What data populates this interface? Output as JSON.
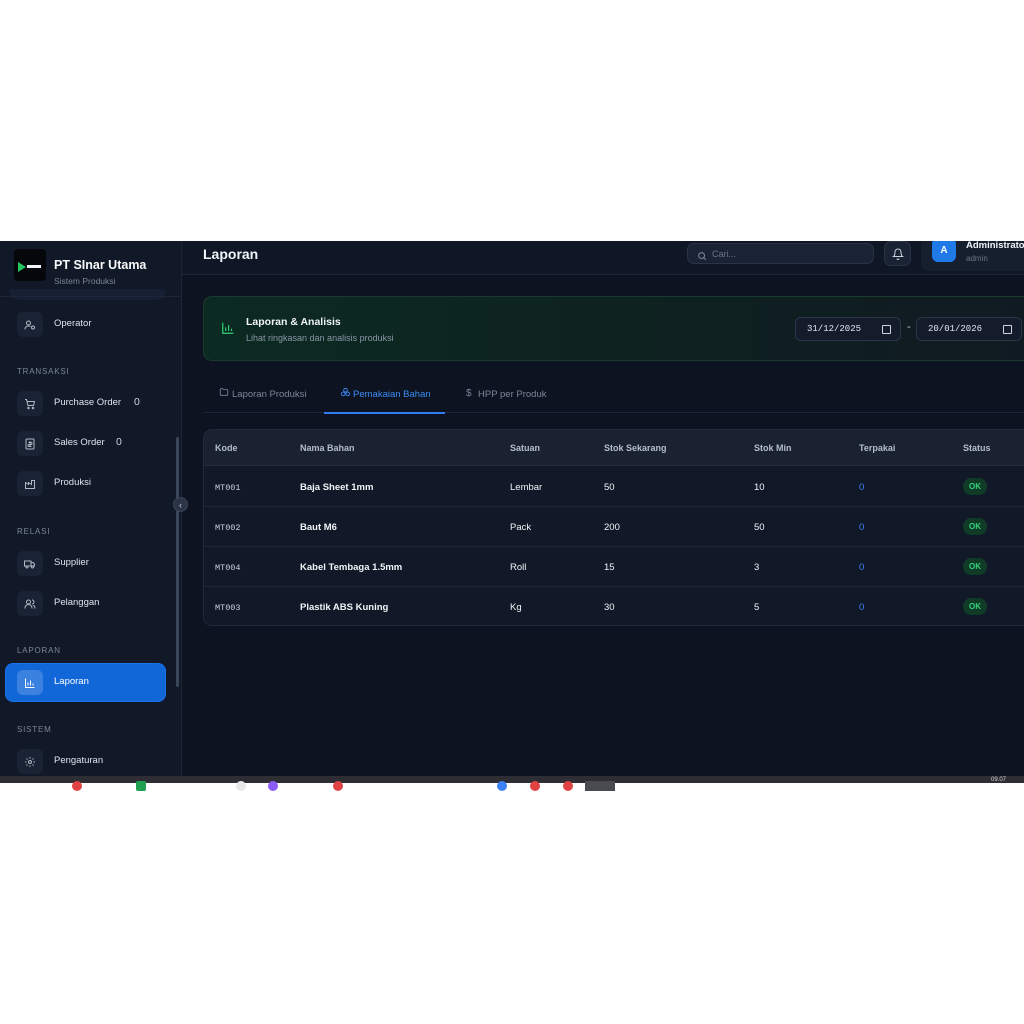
{
  "brand": {
    "name": "PT SInar Utama",
    "subtitle": "Sistem Produksi"
  },
  "sidebar": {
    "sections": {
      "transaksi": "TRANSAKSI",
      "relasi": "RELASI",
      "laporan": "LAPORAN",
      "sistem": "SISTEM"
    },
    "items": {
      "operator": {
        "label": "Operator",
        "icon": "user-cog-icon"
      },
      "purchase_order": {
        "label": "Purchase Order",
        "count": "0",
        "icon": "cart-icon"
      },
      "sales_order": {
        "label": "Sales Order",
        "count": "0",
        "icon": "receipt-icon"
      },
      "produksi": {
        "label": "Produksi",
        "icon": "factory-icon"
      },
      "supplier": {
        "label": "Supplier",
        "icon": "truck-icon"
      },
      "pelanggan": {
        "label": "Pelanggan",
        "icon": "users-icon"
      },
      "laporan": {
        "label": "Laporan",
        "icon": "bar-chart-icon",
        "active": true
      },
      "pengaturan": {
        "label": "Pengaturan",
        "icon": "gear-icon"
      }
    },
    "collapse_icon": "chevron-left-icon"
  },
  "header": {
    "title": "Laporan",
    "search_placeholder": "Cari...",
    "user": {
      "initial": "A",
      "name": "Administrator",
      "role": "admin"
    }
  },
  "banner": {
    "title": "Laporan & Analisis",
    "subtitle": "Lihat ringkasan dan analisis produksi",
    "date_from": "31/12/2025",
    "date_separator": "-",
    "date_to": "20/01/2026"
  },
  "tabs": [
    {
      "label": "Laporan Produksi",
      "icon": "folder-icon"
    },
    {
      "label": "Pemakaian Bahan",
      "icon": "layers-icon",
      "active": true
    },
    {
      "label": "HPP per Produk",
      "icon": "dollar-icon"
    }
  ],
  "table": {
    "columns": [
      "Kode",
      "Nama Bahan",
      "Satuan",
      "Stok Sekarang",
      "Stok Min",
      "Terpakai",
      "Status"
    ],
    "rows": [
      {
        "kode": "MT001",
        "nama": "Baja Sheet 1mm",
        "satuan": "Lembar",
        "stok": "50",
        "min": "10",
        "terpakai": "0",
        "status": "OK"
      },
      {
        "kode": "MT002",
        "nama": "Baut M6",
        "satuan": "Pack",
        "stok": "200",
        "min": "50",
        "terpakai": "0",
        "status": "OK"
      },
      {
        "kode": "MT004",
        "nama": "Kabel Tembaga 1.5mm",
        "satuan": "Roll",
        "stok": "15",
        "min": "3",
        "terpakai": "0",
        "status": "OK"
      },
      {
        "kode": "MT003",
        "nama": "Plastik ABS Kuning",
        "satuan": "Kg",
        "stok": "30",
        "min": "5",
        "terpakai": "0",
        "status": "OK"
      }
    ]
  },
  "colors": {
    "accent": "#1166d8",
    "success": "#34d37a",
    "background": "#0d1320",
    "sidebar": "#111827"
  },
  "taskbar": {
    "clock": "09.07"
  }
}
